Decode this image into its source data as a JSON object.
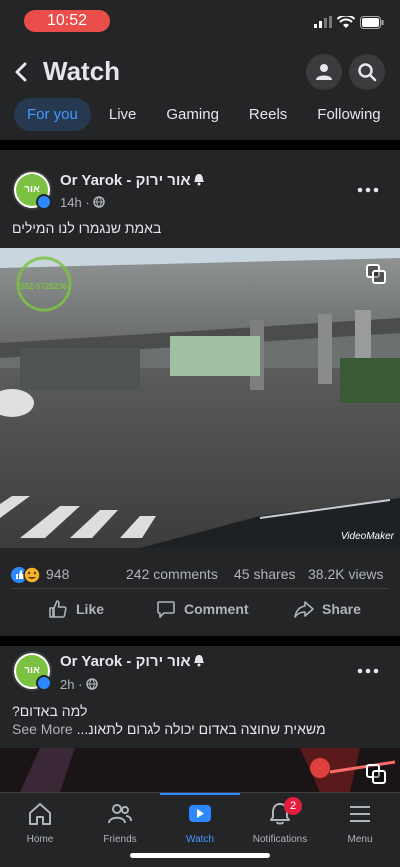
{
  "status": {
    "time": "10:52"
  },
  "header": {
    "title": "Watch",
    "tabs": [
      "For you",
      "Live",
      "Gaming",
      "Reels",
      "Following"
    ]
  },
  "posts": [
    {
      "author": "Or Yarok - אור ירוק",
      "time": "14h",
      "text": "באמת שנגמרו לנו המילים",
      "avatar_text": "אור ירוק",
      "video_watermark": "VideoMaker",
      "video_overlay_phone": "052-5725236",
      "reaction_count": "948",
      "comments": "242 comments",
      "shares": "45 shares",
      "views": "38.2K views",
      "actions": {
        "like": "Like",
        "comment": "Comment",
        "share": "Share"
      }
    },
    {
      "author": "Or Yarok - אור ירוק",
      "time": "2h",
      "text_line1": "למה באדום?",
      "text_line2": "משאית שחוצה באדום יכולה לגרום לתאונ...",
      "see_more": "See More",
      "avatar_text": "אור ירוק"
    }
  ],
  "nav": {
    "items": [
      "Home",
      "Friends",
      "Watch",
      "Notifications",
      "Menu"
    ],
    "notifications_badge": "2"
  },
  "colors": {
    "accent": "#2d88ff",
    "background": "#18191a",
    "surface": "#242526",
    "badge": "#e41e3f"
  }
}
